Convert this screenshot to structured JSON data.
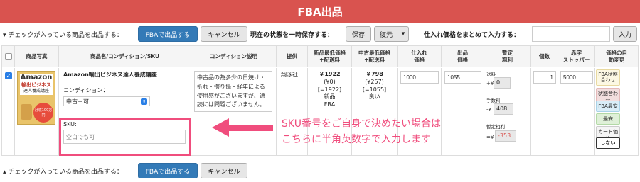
{
  "header": {
    "title": "FBA出品"
  },
  "top_toolbar": {
    "list_checked_text": "▾ チェックが入っている商品を出品する：",
    "list_fba_button": "FBAで出品する",
    "cancel_button": "キャンセル",
    "save_state_text": "現在の状態を一時保存する：",
    "save_button": "保存",
    "restore_button": "復元",
    "restore_caret": "▾",
    "bulk_price_text": "仕入れ価格をまとめて入力する：",
    "bulk_price_value": "",
    "input_button": "入力"
  },
  "table": {
    "headers": {
      "photo": "商品写真",
      "name": "商品名/コンディション/SKU",
      "condition_desc": "コンディション説明",
      "provider": "提供",
      "new_min_price": "新品最低価格\n+配送料",
      "used_min_price": "中古最低価格\n+配送料",
      "purchase_price": "仕入れ\n価格",
      "listing_price": "出品\n価格",
      "provisional_profit": "暫定\n粗利",
      "quantity": "個数",
      "stopper": "赤字\nストッパー",
      "auto_change": "価格の自\n動変更"
    },
    "row": {
      "checked": true,
      "product_image": {
        "title_line1": "Amazon",
        "title_line2": "輸出ビジネス",
        "title_line3": "達人養成講座",
        "badge": "月収100万円"
      },
      "product_name": "Amazon輸出ビジネス達人養成講座",
      "condition_label": "コンディション：",
      "condition_value": "中古－可",
      "sku_label": "SKU:",
      "sku_placeholder": "空白でも可",
      "condition_description": "中古品の為多少の日焼け・折れ・擦り傷・経年による使用感がございますが、通読には問題ございません。",
      "provider": "翔泳社",
      "new_price": "￥1922",
      "new_shipping": "(¥0)",
      "new_total": "[=1922]",
      "new_type": "新品",
      "new_channel": "FBA",
      "used_price": "￥798",
      "used_shipping": "(¥257)",
      "used_total": "[=1055]",
      "used_condition": "良い",
      "purchase_price": "1000",
      "listing_price": "1055",
      "shipping_label": "送料",
      "shipping_sign": "+¥",
      "shipping_value": "0",
      "fee_label": "手数料",
      "fee_sign": "-¥",
      "fee_value": "408",
      "profit_label": "暫定粗利",
      "profit_sign": "=¥",
      "profit_value": "-353",
      "quantity": "1",
      "stopper": "5000",
      "auto_options": [
        "FBA状態合わせ",
        "状態合わせ",
        "FBA最安",
        "最安",
        "カート価格",
        "しない"
      ]
    }
  },
  "annotation": {
    "line1": "SKU番号をご自身で決めたい場合は",
    "line2": "こちらに半角英数字で入力します"
  },
  "bottom_toolbar": {
    "list_checked_text": "▴ チェックが入っている商品を出品する：",
    "list_fba_button": "FBAで出品する",
    "cancel_button": "キャンセル"
  },
  "colors": {
    "header_bg": "#d9534f",
    "primary_button": "#337ab7",
    "annotation_pink": "#f04d7d",
    "profit_negative": "#d9534f"
  }
}
